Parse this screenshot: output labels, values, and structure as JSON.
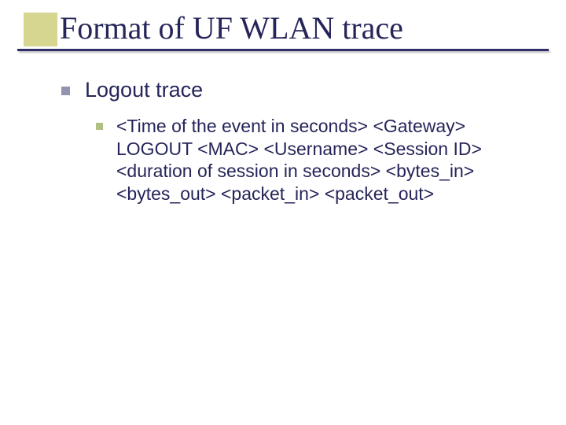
{
  "slide": {
    "title": "Format of UF WLAN trace",
    "level1": "Logout trace",
    "level2": "<Time of the event in seconds>  <Gateway>  LOGOUT  <MAC>  <Username> <Session ID> <duration of session in seconds> <bytes_in> <bytes_out> <packet_in> <packet_out>"
  }
}
